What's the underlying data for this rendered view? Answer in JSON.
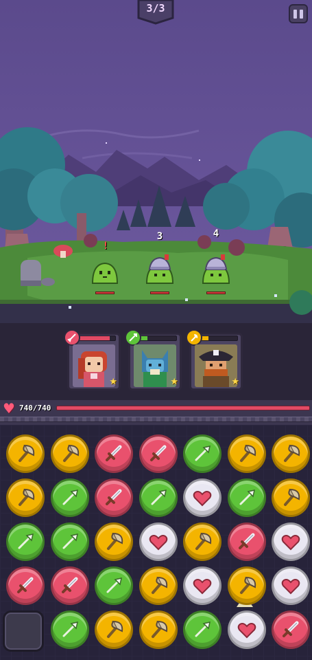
{
  "battle": {
    "wave_label": "3/3",
    "pause_icon": "pause-icon"
  },
  "enemies": [
    {
      "type": "green-slime",
      "marker": "!",
      "hp_fraction": 1.0
    },
    {
      "type": "helmet-slime",
      "marker": "3",
      "hp_fraction": 1.0
    },
    {
      "type": "helmet-slime",
      "marker": "4",
      "hp_fraction": 1.0
    }
  ],
  "heroes": [
    {
      "name": "red-haired-swordswoman",
      "skill_icon": "sword-icon",
      "skill_color": "#e9516d",
      "charge_fraction": 0.85,
      "stars": 1
    },
    {
      "name": "blue-cat-archer",
      "skill_icon": "spear-icon",
      "skill_color": "#5ec43a",
      "charge_fraction": 0.2,
      "stars": 1
    },
    {
      "name": "pirate-captain",
      "skill_icon": "axe-icon",
      "skill_color": "#f4b400",
      "charge_fraction": 0.2,
      "stars": 1
    }
  ],
  "party": {
    "hp_text": "740/740",
    "hp_fraction": 1.0
  },
  "board": {
    "rows": [
      [
        "axe",
        "axe",
        "sword",
        "sword",
        "spear",
        "axe",
        "axe"
      ],
      [
        "axe",
        "spear",
        "sword",
        "spear",
        "heart",
        "spear",
        "axe"
      ],
      [
        "spear",
        "spear",
        "axe",
        "heart",
        "axe",
        "sword",
        "heart"
      ],
      [
        "sword",
        "sword",
        "spear",
        "axe",
        "heart",
        "axe",
        "heart"
      ],
      [
        "empty",
        "spear",
        "axe",
        "axe",
        "spear",
        "heart",
        "sword"
      ]
    ],
    "colors": {
      "axe": "#f4b400",
      "sword": "#e9516d",
      "spear": "#5ec43a",
      "heart": "#e9e7f2"
    }
  }
}
